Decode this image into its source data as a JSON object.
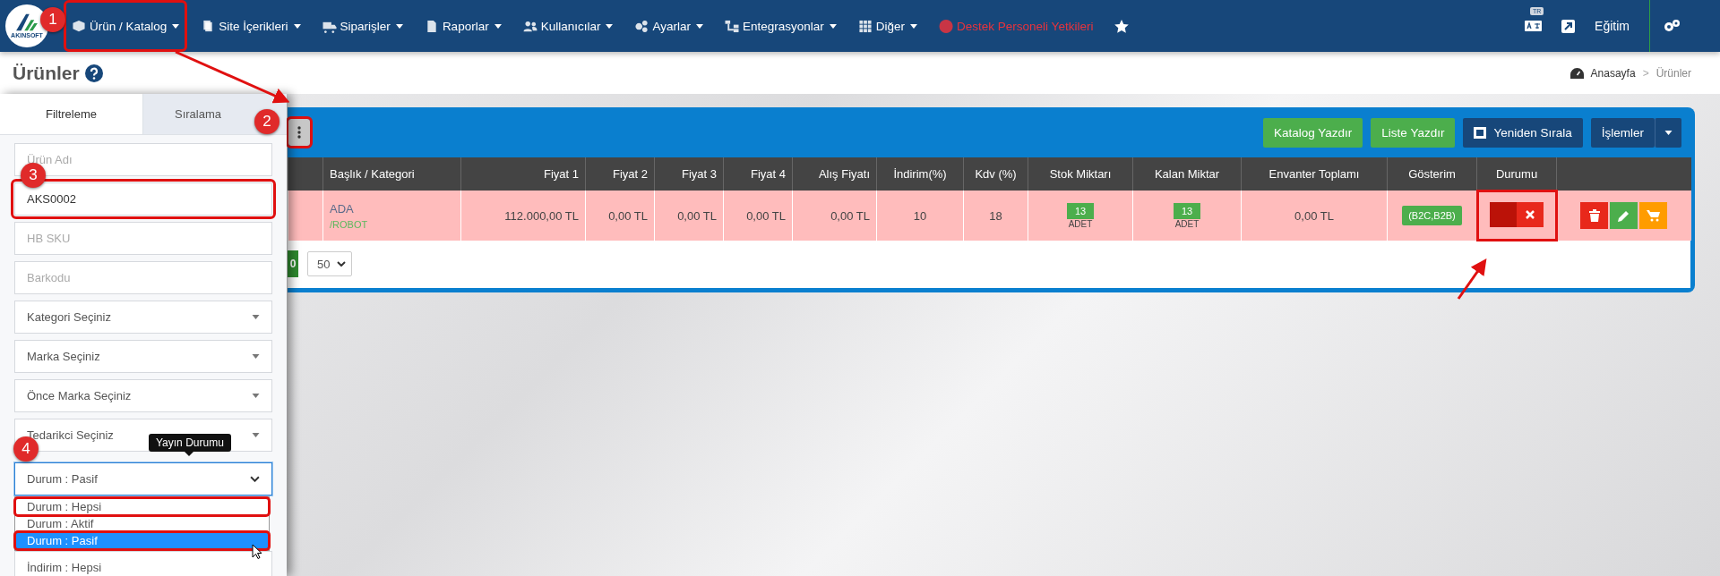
{
  "logo": {
    "text": "AKINSOFT"
  },
  "nav": {
    "items": [
      {
        "label": "Ürün / Katalog",
        "color": "#ffffff",
        "dropdown": true,
        "highlighted": true
      },
      {
        "label": "Site İçerikleri",
        "color": "#ffffff",
        "dropdown": true,
        "highlighted": false
      },
      {
        "label": "Siparişler",
        "color": "#ffffff",
        "dropdown": true,
        "highlighted": false
      },
      {
        "label": "Raporlar",
        "color": "#ffffff",
        "dropdown": true,
        "highlighted": false
      },
      {
        "label": "Kullanıcılar",
        "color": "#ffffff",
        "dropdown": true,
        "highlighted": false
      },
      {
        "label": "Ayarlar",
        "color": "#ffffff",
        "dropdown": true,
        "highlighted": false
      },
      {
        "label": "Entegrasyonlar",
        "color": "#ffffff",
        "dropdown": true,
        "highlighted": false
      },
      {
        "label": "Diğer",
        "color": "#ffffff",
        "dropdown": true,
        "highlighted": false
      },
      {
        "label": "Destek Personeli Yetkileri",
        "color": "#e8333c",
        "dropdown": false,
        "highlighted": false
      }
    ],
    "language_badge": "TR",
    "user_label": "Eğitim"
  },
  "page": {
    "title": "Ürünler",
    "breadcrumb": [
      "Anasayfa",
      "Ürünler"
    ],
    "breadcrumb_separator": ">"
  },
  "filter_panel": {
    "tabs": [
      {
        "label": "Filtreleme",
        "selected": true
      },
      {
        "label": "Sıralama",
        "selected": false
      }
    ],
    "fields": [
      {
        "kind": "input",
        "placeholder": "Ürün Adı",
        "highlighted": false
      },
      {
        "kind": "input",
        "value": "AKS0002",
        "highlighted": true
      },
      {
        "kind": "input",
        "placeholder": "HB SKU",
        "highlighted": false
      },
      {
        "kind": "input",
        "placeholder": "Barkodu",
        "highlighted": false
      },
      {
        "kind": "select",
        "value": "Kategori Seçiniz",
        "highlighted": false
      },
      {
        "kind": "select",
        "value": "Marka Seçiniz",
        "highlighted": false
      },
      {
        "kind": "select",
        "value": "Önce Marka Seçiniz",
        "highlighted": false
      },
      {
        "kind": "select",
        "value": "Tedarikci Seçiniz",
        "highlighted": false
      }
    ],
    "status_select": {
      "value": "Durum : Pasif",
      "tooltip": "Yayın Durumu",
      "expanded": true,
      "options": [
        {
          "label": "Durum : Hepsi",
          "selected": false,
          "highlighted": true
        },
        {
          "label": "Durum : Aktif",
          "selected": false,
          "highlighted": false
        },
        {
          "label": "Durum : Pasif",
          "selected": true,
          "highlighted": true
        }
      ]
    },
    "next_field": {
      "value": "İndirim : Hepsi"
    }
  },
  "toolbar": {
    "menu_highlighted": true,
    "buttons": [
      {
        "label": "Katalog Yazdır",
        "kind": "green"
      },
      {
        "label": "Liste Yazdır",
        "kind": "green"
      },
      {
        "label": "Yeniden Sırala",
        "kind": "navy"
      },
      {
        "label": "İşlemler",
        "kind": "split"
      }
    ]
  },
  "table": {
    "columns": [
      "Başlık / Kategori",
      "Fiyat 1",
      "Fiyat 2",
      "Fiyat 3",
      "Fiyat 4",
      "Alış Fiyatı",
      "İndirim(%)",
      "Kdv (%)",
      "Stok Miktarı",
      "Kalan Miktar",
      "Envanter Toplamı",
      "Gösterim",
      "Durumu"
    ],
    "rows": [
      {
        "title": "ADA",
        "category": "/ROBOT",
        "prices": [
          "112.000,00 TL",
          "0,00 TL",
          "0,00 TL",
          "0,00 TL",
          "0,00 TL"
        ],
        "discount": "10",
        "vat": "18",
        "stock": {
          "count": "13",
          "unit": "ADET"
        },
        "remaining": {
          "count": "13",
          "unit": "ADET"
        },
        "inventory_total": "0,00 TL",
        "display": "(B2C,B2B)",
        "active": false,
        "status_highlighted": true
      }
    ]
  },
  "pagination": {
    "page": "0",
    "page_size": "50"
  },
  "annotations": [
    {
      "label": "1"
    },
    {
      "label": "2"
    },
    {
      "label": "3"
    },
    {
      "label": "4"
    }
  ]
}
